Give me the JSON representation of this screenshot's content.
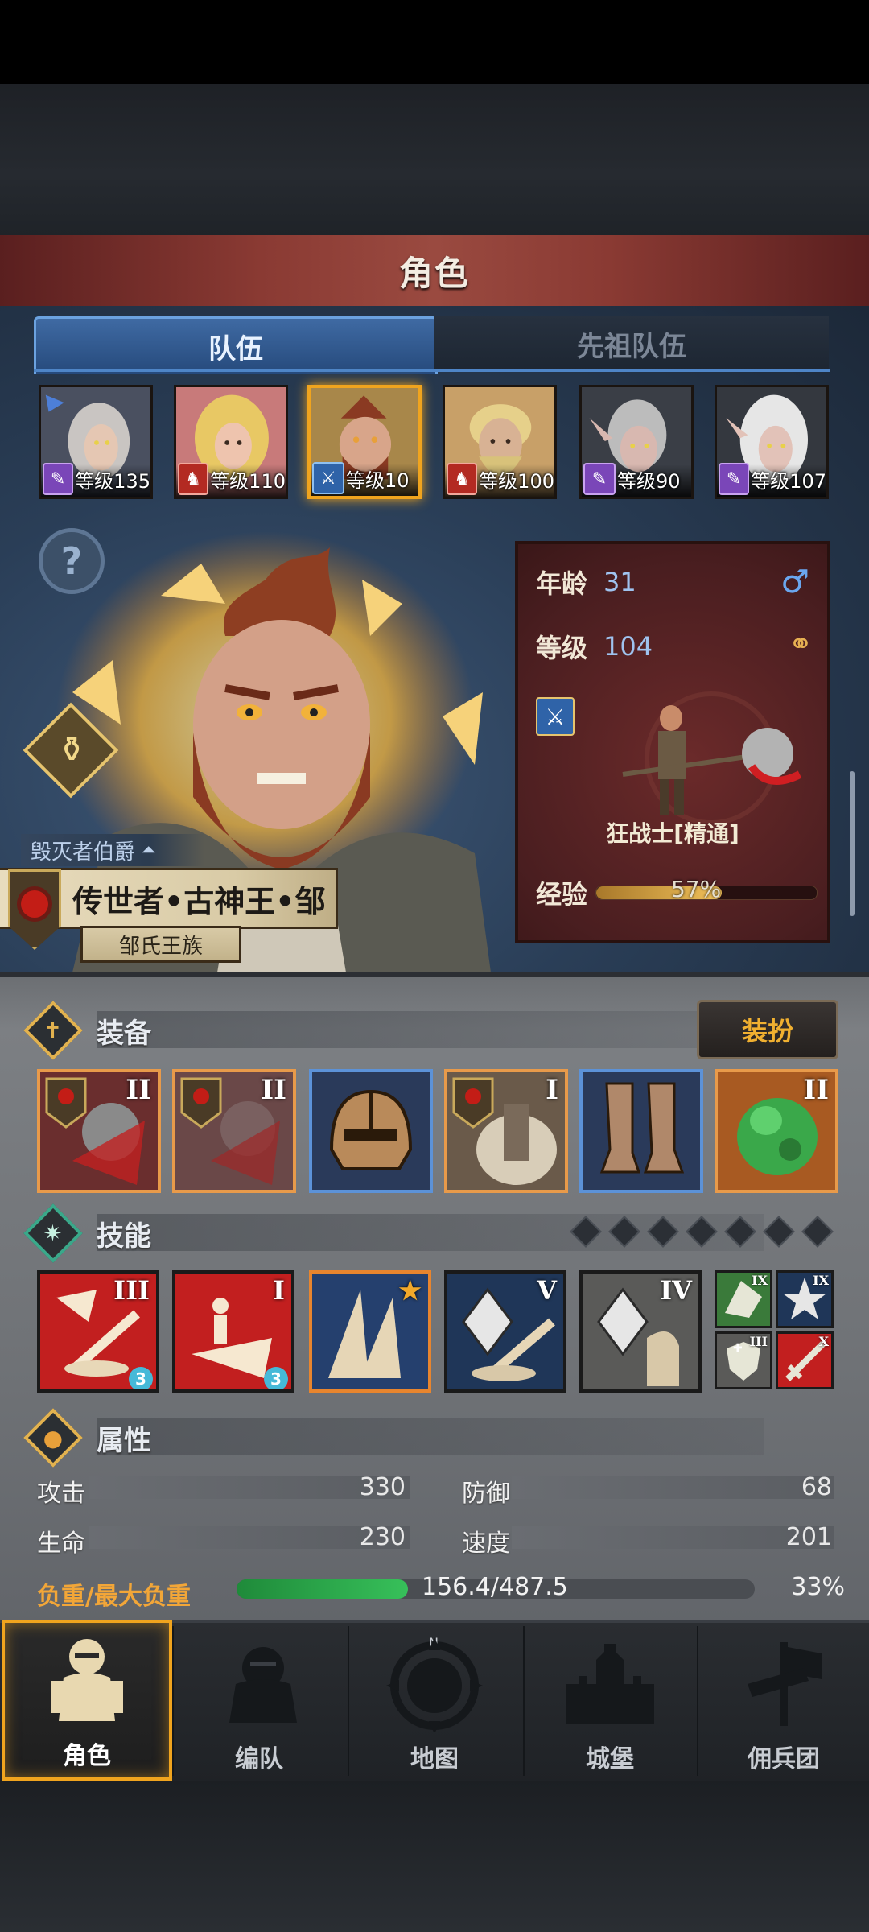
{
  "header": {
    "title": "角色"
  },
  "tabs": [
    {
      "label": "队伍",
      "active": true
    },
    {
      "label": "先祖队伍",
      "active": false
    }
  ],
  "party": [
    {
      "level_text": "等级135",
      "class": "purple",
      "selected": false
    },
    {
      "level_text": "等级110",
      "class": "red",
      "selected": false
    },
    {
      "level_text": "等级10",
      "class": "blue",
      "selected": true
    },
    {
      "level_text": "等级100",
      "class": "red",
      "selected": false
    },
    {
      "level_text": "等级90",
      "class": "purple",
      "selected": false
    },
    {
      "level_text": "等级107",
      "class": "purple",
      "selected": false
    }
  ],
  "hero": {
    "rank_title": "毁灭者伯爵",
    "name": "传世者•古神王•邹",
    "family": "邹氏王族"
  },
  "info": {
    "age_label": "年龄",
    "age_value": "31",
    "level_label": "等级",
    "level_value": "104",
    "class_name": "狂战士[精通]",
    "exp_label": "经验",
    "exp_text": "57%",
    "exp_fraction": 0.57
  },
  "equipment": {
    "title": "装备",
    "dress_button": "装扮",
    "slots": [
      {
        "tier": "II",
        "rarity": "orange"
      },
      {
        "tier": "II",
        "rarity": "orange"
      },
      {
        "tier": "",
        "rarity": "blue"
      },
      {
        "tier": "I",
        "rarity": "orange"
      },
      {
        "tier": "",
        "rarity": "blue"
      },
      {
        "tier": "II",
        "rarity": "orange"
      }
    ]
  },
  "skills": {
    "title": "技能",
    "slots": [
      {
        "tier": "III",
        "count": "3"
      },
      {
        "tier": "I",
        "count": "3"
      },
      {
        "tier": "",
        "count": ""
      },
      {
        "tier": "V",
        "count": ""
      },
      {
        "tier": "IV",
        "count": ""
      }
    ],
    "mini": [
      {
        "tier": "IX"
      },
      {
        "tier": "IX"
      },
      {
        "tier": "III"
      },
      {
        "tier": "X"
      }
    ]
  },
  "attributes": {
    "title": "属性",
    "attack_label": "攻击",
    "attack_value": "330",
    "defense_label": "防御",
    "defense_value": "68",
    "hp_label": "生命",
    "hp_value": "230",
    "speed_label": "速度",
    "speed_value": "201",
    "weight_label": "负重/最大负重",
    "weight_text": "156.4/487.5",
    "weight_pct": "33%",
    "weight_fraction": 0.33
  },
  "nav": [
    {
      "label": "角色",
      "active": true
    },
    {
      "label": "编队",
      "active": false
    },
    {
      "label": "地图",
      "active": false
    },
    {
      "label": "城堡",
      "active": false
    },
    {
      "label": "佣兵团",
      "active": false
    }
  ],
  "colors": {
    "accent_gold": "#f0a41e",
    "title_red": "#8a3a33",
    "tab_blue": "#3f6aa3",
    "weight_green": "#37c05a"
  }
}
